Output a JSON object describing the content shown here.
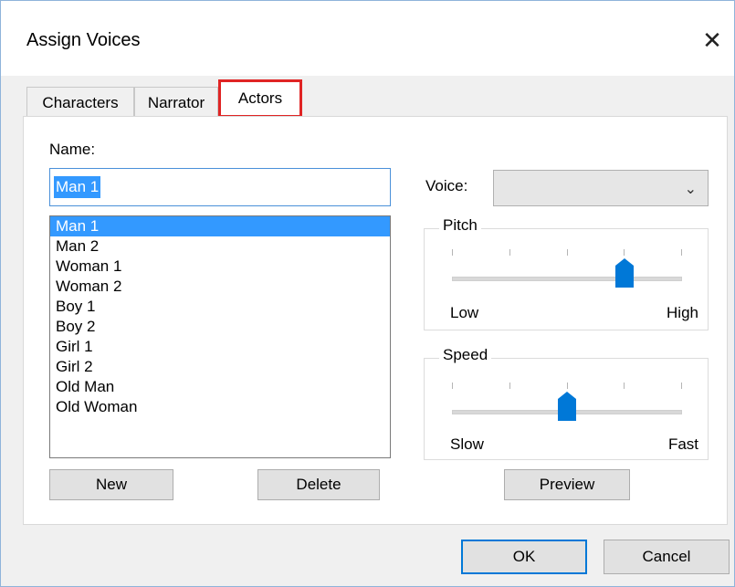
{
  "window": {
    "title": "Assign Voices",
    "close_label": "✕"
  },
  "tabs": [
    {
      "label": "Characters"
    },
    {
      "label": "Narrator"
    },
    {
      "label": "Actors",
      "active": true
    }
  ],
  "actors": {
    "name_label": "Name:",
    "name_value": "Man 1",
    "items": [
      "Man 1",
      "Man 2",
      "Woman 1",
      "Woman 2",
      "Boy 1",
      "Boy 2",
      "Girl 1",
      "Girl 2",
      "Old Man",
      "Old Woman"
    ],
    "selected_index": 0,
    "new_label": "New",
    "delete_label": "Delete"
  },
  "voice": {
    "label": "Voice:",
    "value": ""
  },
  "pitch": {
    "title": "Pitch",
    "low_label": "Low",
    "high_label": "High",
    "level": 0.75,
    "ticks": 5
  },
  "speed": {
    "title": "Speed",
    "low_label": "Slow",
    "high_label": "Fast",
    "level": 0.5,
    "ticks": 5
  },
  "preview_label": "Preview",
  "footer": {
    "ok_label": "OK",
    "cancel_label": "Cancel"
  },
  "colors": {
    "accent": "#0078d7",
    "selection": "#3399ff",
    "tab_highlight": "#e02424"
  }
}
